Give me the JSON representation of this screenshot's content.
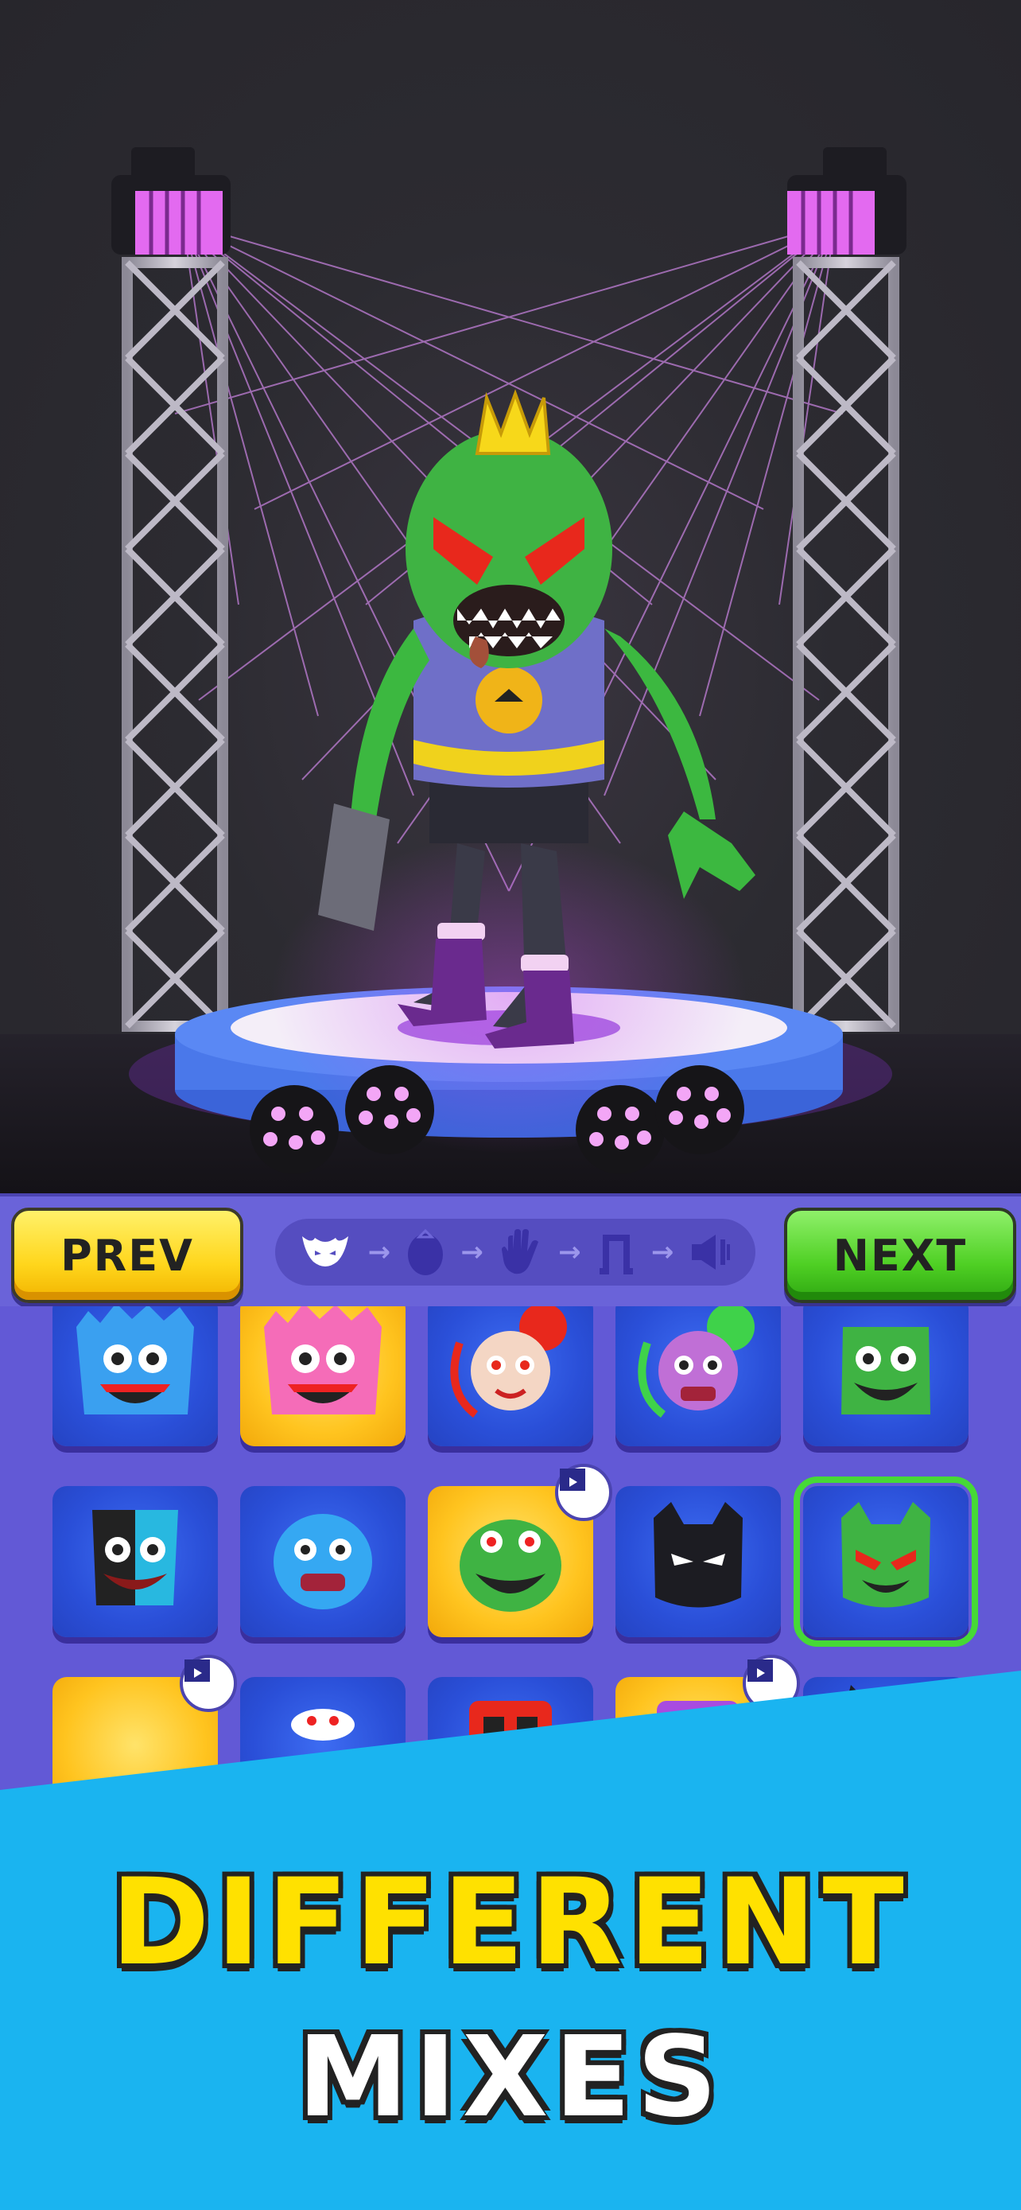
{
  "toolbar": {
    "prev_label": "PREV",
    "next_label": "NEXT",
    "steps": [
      "head-icon",
      "egg-body-icon",
      "hand-icon",
      "legs-icon",
      "speaker-icon"
    ]
  },
  "grid": {
    "items": [
      {
        "name": "blue-furry-monster",
        "style": "blue"
      },
      {
        "name": "pink-furry-monster",
        "style": "gold"
      },
      {
        "name": "red-hair-doll",
        "style": "blue"
      },
      {
        "name": "green-hair-doll",
        "style": "blue"
      },
      {
        "name": "green-slime-monster",
        "style": "blue"
      },
      {
        "name": "split-face-monster",
        "style": "blue"
      },
      {
        "name": "blue-blob-monster",
        "style": "blue"
      },
      {
        "name": "green-toothy-monster",
        "style": "gold",
        "video": true
      },
      {
        "name": "black-bat-mask",
        "style": "blue"
      },
      {
        "name": "green-devil-mask",
        "style": "blue",
        "selected": true
      },
      {
        "name": "masked-item",
        "style": "gold",
        "video": true
      },
      {
        "name": "white-spider-face",
        "style": "blue"
      },
      {
        "name": "red-box-monster",
        "style": "blue"
      },
      {
        "name": "purple-box-monster",
        "style": "gold",
        "video": true
      },
      {
        "name": "cartoon-cat",
        "style": "blue"
      }
    ]
  },
  "banner": {
    "line1": "DIFFERENT",
    "line2": "MIXES"
  },
  "colors": {
    "stage_bg": "#2c2b31",
    "toolbar": "#6a63d9",
    "panel": "#6259d6",
    "banner": "#1ab4f0",
    "prev": "#ffd61c",
    "next": "#4fd024",
    "selected": "#46d936"
  }
}
